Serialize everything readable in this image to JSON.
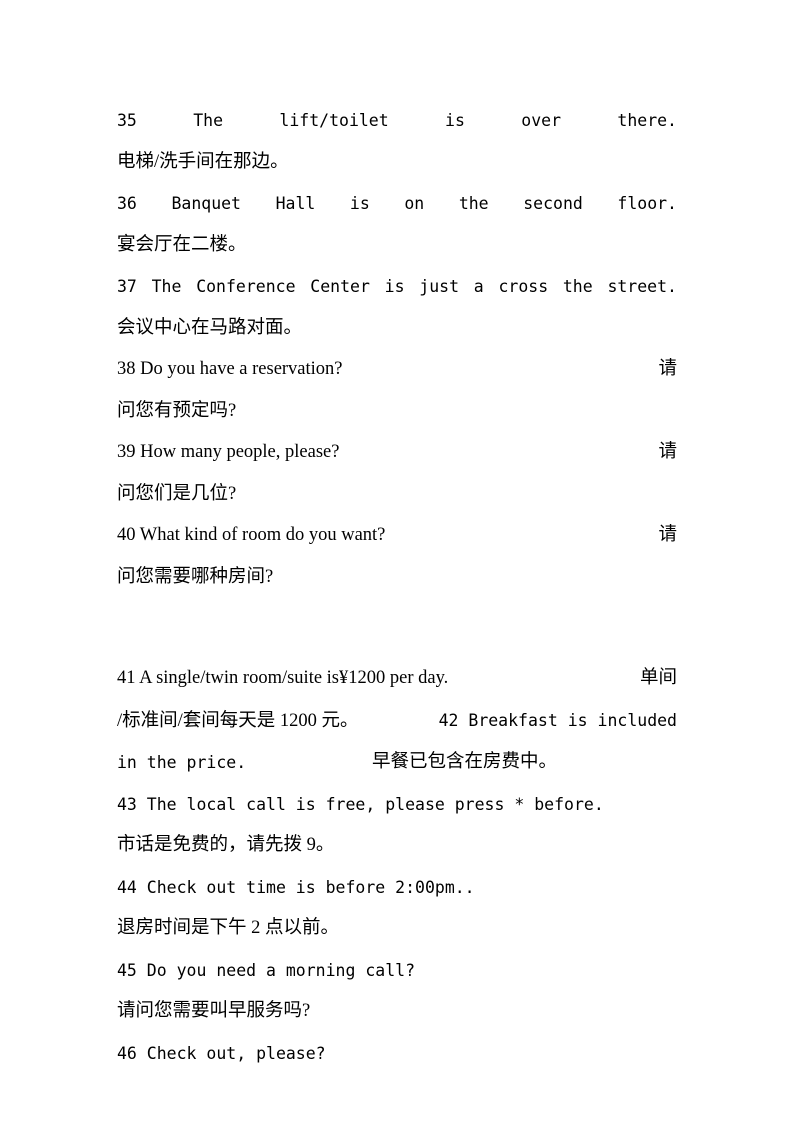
{
  "document": {
    "type": "bilingual-phrasebook-page",
    "page_background": "#ffffff",
    "text_color": "#000000",
    "entries": [
      {
        "number": "35",
        "english_words": [
          "35",
          "The",
          "lift/toilet",
          "is",
          "over",
          "there."
        ],
        "english_full": "35 The lift/toilet is over there.",
        "chinese": "电梯/洗手间在那边。",
        "style": "mono-justified"
      },
      {
        "number": "36",
        "english_words": [
          "36",
          "Banquet",
          "Hall",
          "is",
          "on",
          "the",
          "second",
          "floor."
        ],
        "english_full": "36 Banquet Hall is on the second floor.",
        "chinese": "宴会厅在二楼。",
        "style": "mono-justified"
      },
      {
        "number": "37",
        "english_words": [
          "37",
          "The",
          "Conference",
          "Center",
          "is",
          "just",
          "a",
          "cross",
          "the",
          "street."
        ],
        "english_full": "37 The Conference Center is just a cross the street.",
        "chinese": "会议中心在马路对面。",
        "style": "mono-justified"
      },
      {
        "number": "38",
        "english_full": "38 Do you have a reservation?",
        "overflow_char": "请",
        "chinese": "问您有预定吗?",
        "style": "serif-split"
      },
      {
        "number": "39",
        "english_full": "39 How many people, please?",
        "overflow_char": "请",
        "chinese": "问您们是几位?",
        "style": "serif-split"
      },
      {
        "number": "40",
        "english_full": "40 What kind of room do you want?",
        "overflow_char": "请",
        "chinese": "问您需要哪种房间?",
        "style": "serif-split"
      }
    ],
    "block_41_42": {
      "line1_left": "41 A single/twin room/suite is¥1200 per day.",
      "line1_right": "单间",
      "line2_left": "/标准间/套间每天是 1200 元。",
      "line2_right": "42 Breakfast is included",
      "line3_left": "in the price.",
      "line3_right": "早餐已包含在房费中。"
    },
    "entries_tail": [
      {
        "number": "43",
        "english_full": "43 The local call is free, please press * before.",
        "chinese": "市话是免费的，请先拨 9。",
        "style": "mono-plain"
      },
      {
        "number": "44",
        "english_full": "44 Check out time is before 2:00pm..",
        "chinese": "退房时间是下午 2 点以前。",
        "style": "mono-plain"
      },
      {
        "number": "45",
        "english_full": "45 Do you need a morning call?",
        "chinese": "请问您需要叫早服务吗?",
        "style": "mono-plain"
      },
      {
        "number": "46",
        "english_full": "46 Check out, please?",
        "chinese": "",
        "style": "mono-plain"
      }
    ]
  }
}
